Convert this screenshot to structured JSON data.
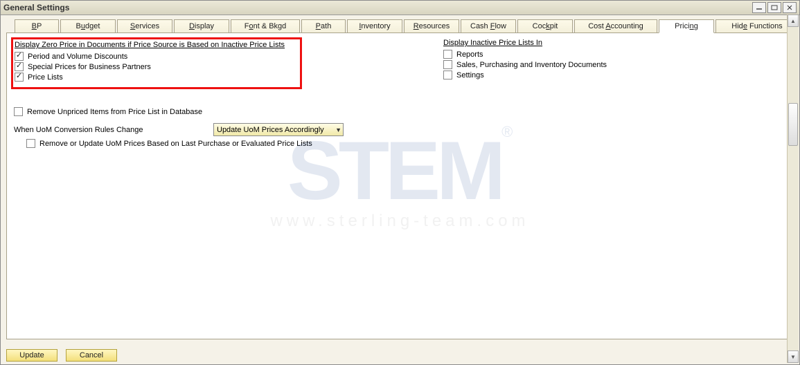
{
  "window": {
    "title": "General Settings"
  },
  "tabs": {
    "items": [
      {
        "html": "<span class='u'>B</span>P"
      },
      {
        "html": "B<span class='u'>u</span>dget"
      },
      {
        "html": "<span class='u'>S</span>ervices"
      },
      {
        "html": "<span class='u'>D</span>isplay"
      },
      {
        "html": "F<span class='u'>o</span>nt & Bkgd"
      },
      {
        "html": "<span class='u'>P</span>ath"
      },
      {
        "html": "<span class='u'>I</span>nventory"
      },
      {
        "html": "<span class='u'>R</span>esources"
      },
      {
        "html": "Cash <span class='u'>F</span>low"
      },
      {
        "html": "Coc<span class='u'>k</span>pit"
      },
      {
        "html": "Cost <span class='u'>A</span>ccounting"
      },
      {
        "html": "Prici<span class='u'>n</span>g"
      },
      {
        "html": "Hid<span class='u'>e</span> Functions"
      }
    ],
    "active_index": 11
  },
  "pricing": {
    "zero_price_title": "Display Zero Price in Documents if Price Source is Based on Inactive Price Lists",
    "zero_price_items": [
      {
        "label": "Period and Volume Discounts",
        "checked": true
      },
      {
        "label": "Special Prices for Business Partners",
        "checked": true
      },
      {
        "label": "Price Lists",
        "checked": true
      }
    ],
    "inactive_title": "Display Inactive Price Lists In",
    "inactive_items": [
      {
        "label": "Reports",
        "checked": false
      },
      {
        "label": "Sales, Purchasing and Inventory Documents",
        "checked": false
      },
      {
        "label": "Settings",
        "checked": false
      }
    ],
    "remove_unpriced": {
      "label": "Remove Unpriced Items from Price List in Database",
      "checked": false
    },
    "uom_change_label": "When UoM Conversion Rules Change",
    "uom_dropdown_value": "Update UoM Prices Accordingly",
    "uom_remove": {
      "label": "Remove or Update UoM Prices Based on Last Purchase or Evaluated Price Lists",
      "checked": false
    }
  },
  "footer": {
    "update": "Update",
    "cancel": "Cancel"
  },
  "watermark": {
    "brand": "STEM",
    "reg": "®",
    "url": "www.sterling-team.com"
  }
}
